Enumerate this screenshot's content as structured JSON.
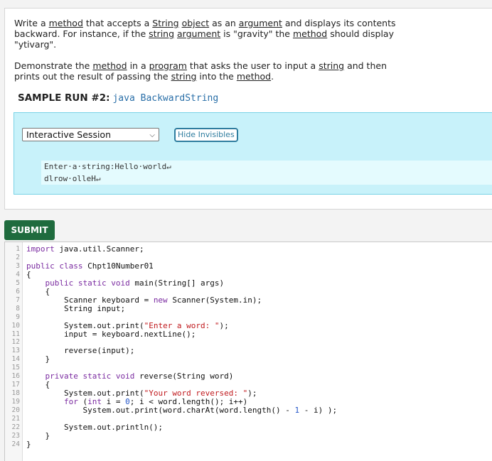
{
  "problem": {
    "p1_a": "Write a ",
    "p1_method": "method",
    "p1_b": " that accepts a ",
    "p1_string": "String",
    "p1_c": " ",
    "p1_object": "object",
    "p1_d": " as an ",
    "p1_argument": "argument",
    "p1_e": " and displays its contents backward. For instance, if the ",
    "p1_string2": "string",
    "p1_f": " ",
    "p1_argument2": "argument",
    "p1_g": " is \"gravity\" the ",
    "p1_method2": "method",
    "p1_h": " should display \"ytivarg\".",
    "p2_a": "Demonstrate the ",
    "p2_method": "method",
    "p2_b": " in a ",
    "p2_program": "program",
    "p2_c": " that asks the user to input a ",
    "p2_string": "string",
    "p2_d": " and then prints out the result of passing the ",
    "p2_string2": "string",
    "p2_e": " into the ",
    "p2_method2": "method",
    "p2_f": "."
  },
  "sample_run": {
    "label": "SAMPLE RUN #2:",
    "command": "java BackwardString"
  },
  "session": {
    "selected": "Interactive Session",
    "hide_label": "Hide Invisibles",
    "output_lines": [
      "Enter·a·string:Hello·world↵",
      "dlrow·olleH↵"
    ]
  },
  "submit_label": "SUBMIT",
  "editor": {
    "line_numbers": [
      "1",
      "2",
      "3",
      "4",
      "5",
      "6",
      "7",
      "8",
      "9",
      "10",
      "11",
      "12",
      "13",
      "14",
      "15",
      "16",
      "17",
      "18",
      "19",
      "20",
      "21",
      "22",
      "23",
      "24"
    ],
    "lines": [
      {
        "ln": 1,
        "parts": [
          [
            "kw",
            "import"
          ],
          [
            "",
            "java.util.Scanner;"
          ]
        ]
      },
      {
        "ln": 3,
        "parts": [
          [
            "kw",
            "public class"
          ],
          [
            "",
            "Chpt10Number01"
          ]
        ]
      },
      {
        "ln": 4,
        "parts": [
          [
            "",
            "{"
          ]
        ]
      },
      {
        "ln": 5,
        "parts": [
          [
            "",
            "    "
          ],
          [
            "kw",
            "public static void"
          ],
          [
            "",
            "main(String[] args)"
          ]
        ]
      },
      {
        "ln": 6,
        "parts": [
          [
            "",
            "    {"
          ]
        ]
      },
      {
        "ln": 7,
        "parts": [
          [
            "",
            "        Scanner keyboard = "
          ],
          [
            "kw",
            "new"
          ],
          [
            "",
            "Scanner(System.in);"
          ]
        ]
      },
      {
        "ln": 8,
        "parts": [
          [
            "",
            "        String input;"
          ]
        ]
      },
      {
        "ln": 10,
        "parts": [
          [
            "",
            "        System.out.print("
          ],
          [
            "str",
            "\"Enter a word: \""
          ],
          [
            "",
            ");"
          ]
        ]
      },
      {
        "ln": 11,
        "parts": [
          [
            "",
            "        input = keyboard.nextLine();"
          ]
        ]
      },
      {
        "ln": 13,
        "parts": [
          [
            "",
            "        reverse(input);"
          ]
        ]
      },
      {
        "ln": 14,
        "parts": [
          [
            "",
            "    }"
          ]
        ]
      },
      {
        "ln": 16,
        "parts": [
          [
            "",
            "    "
          ],
          [
            "kw",
            "private static void"
          ],
          [
            "",
            "reverse(String word)"
          ]
        ]
      },
      {
        "ln": 17,
        "parts": [
          [
            "",
            "    {"
          ]
        ]
      },
      {
        "ln": 18,
        "parts": [
          [
            "",
            "        System.out.print("
          ],
          [
            "str",
            "\"Your word reversed: \""
          ],
          [
            "",
            ");"
          ]
        ]
      },
      {
        "ln": 19,
        "parts": [
          [
            "",
            "        "
          ],
          [
            "kw",
            "for"
          ],
          [
            "",
            "("
          ],
          [
            "kw",
            "int"
          ],
          [
            "",
            "i = "
          ],
          [
            "num",
            "0"
          ],
          [
            "",
            "; i < word.length(); i++)"
          ]
        ]
      },
      {
        "ln": 20,
        "parts": [
          [
            "",
            "            System.out.print(word.charAt(word.length() - "
          ],
          [
            "num",
            "1"
          ],
          [
            "",
            " - i) );"
          ]
        ]
      },
      {
        "ln": 22,
        "parts": [
          [
            "",
            "        System.out.println();"
          ]
        ]
      },
      {
        "ln": 23,
        "parts": [
          [
            "",
            "    }"
          ]
        ]
      },
      {
        "ln": 24,
        "parts": [
          [
            "",
            "}"
          ]
        ]
      }
    ]
  }
}
